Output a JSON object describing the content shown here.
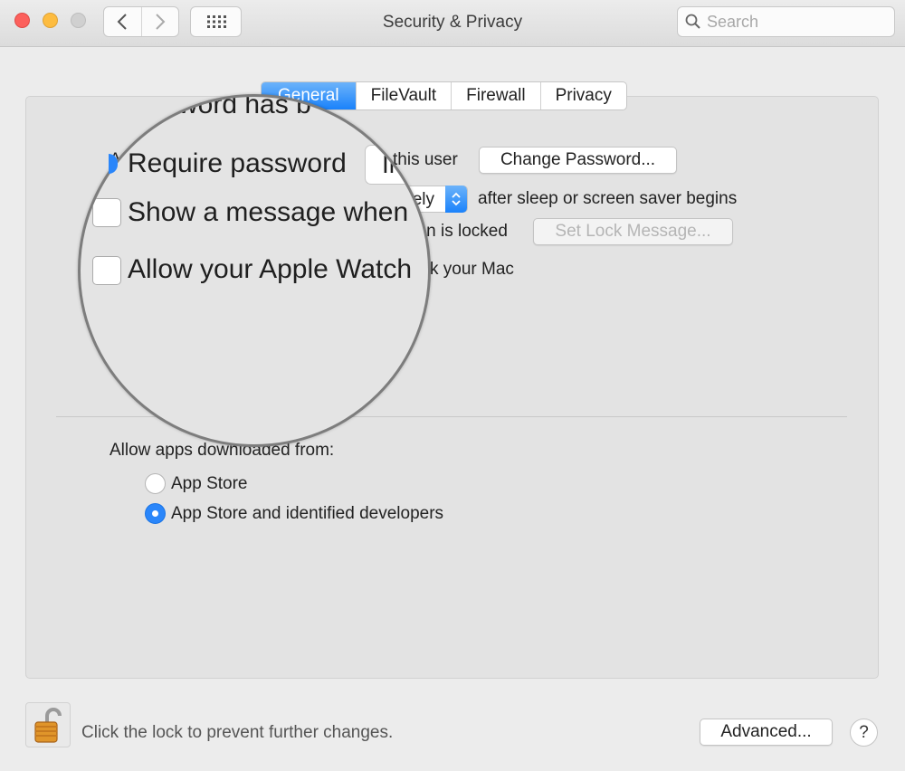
{
  "window": {
    "title": "Security & Privacy"
  },
  "search": {
    "placeholder": "Search"
  },
  "tabs": [
    "General",
    "FileVault",
    "Firewall",
    "Privacy"
  ],
  "general": {
    "label_prefix": "A",
    "this_user_text": "this user",
    "change_password_label": "Change Password...",
    "delay_value": "ely",
    "after_sleep_text": "after sleep or screen saver begins",
    "screen_locked_text": "een is locked",
    "set_lock_message_label": "Set Lock Message...",
    "unlock_mac_text": "k your Mac"
  },
  "magnifier": {
    "top_fragment": "word has b",
    "require_password": "Require password",
    "button_fragment": "Ir",
    "show_message": "Show a message when",
    "allow_watch": "Allow your Apple Watch"
  },
  "gatekeeper": {
    "heading": "Allow apps downloaded from:",
    "options": [
      {
        "label": "App Store",
        "selected": false
      },
      {
        "label": "App Store and identified developers",
        "selected": true
      }
    ]
  },
  "footer": {
    "lock_text": "Click the lock to prevent further changes.",
    "advanced_label": "Advanced...",
    "help_label": "?"
  },
  "colors": {
    "accent": "#1a82fb",
    "close": "#fc605c",
    "minimize": "#fdbc40"
  }
}
